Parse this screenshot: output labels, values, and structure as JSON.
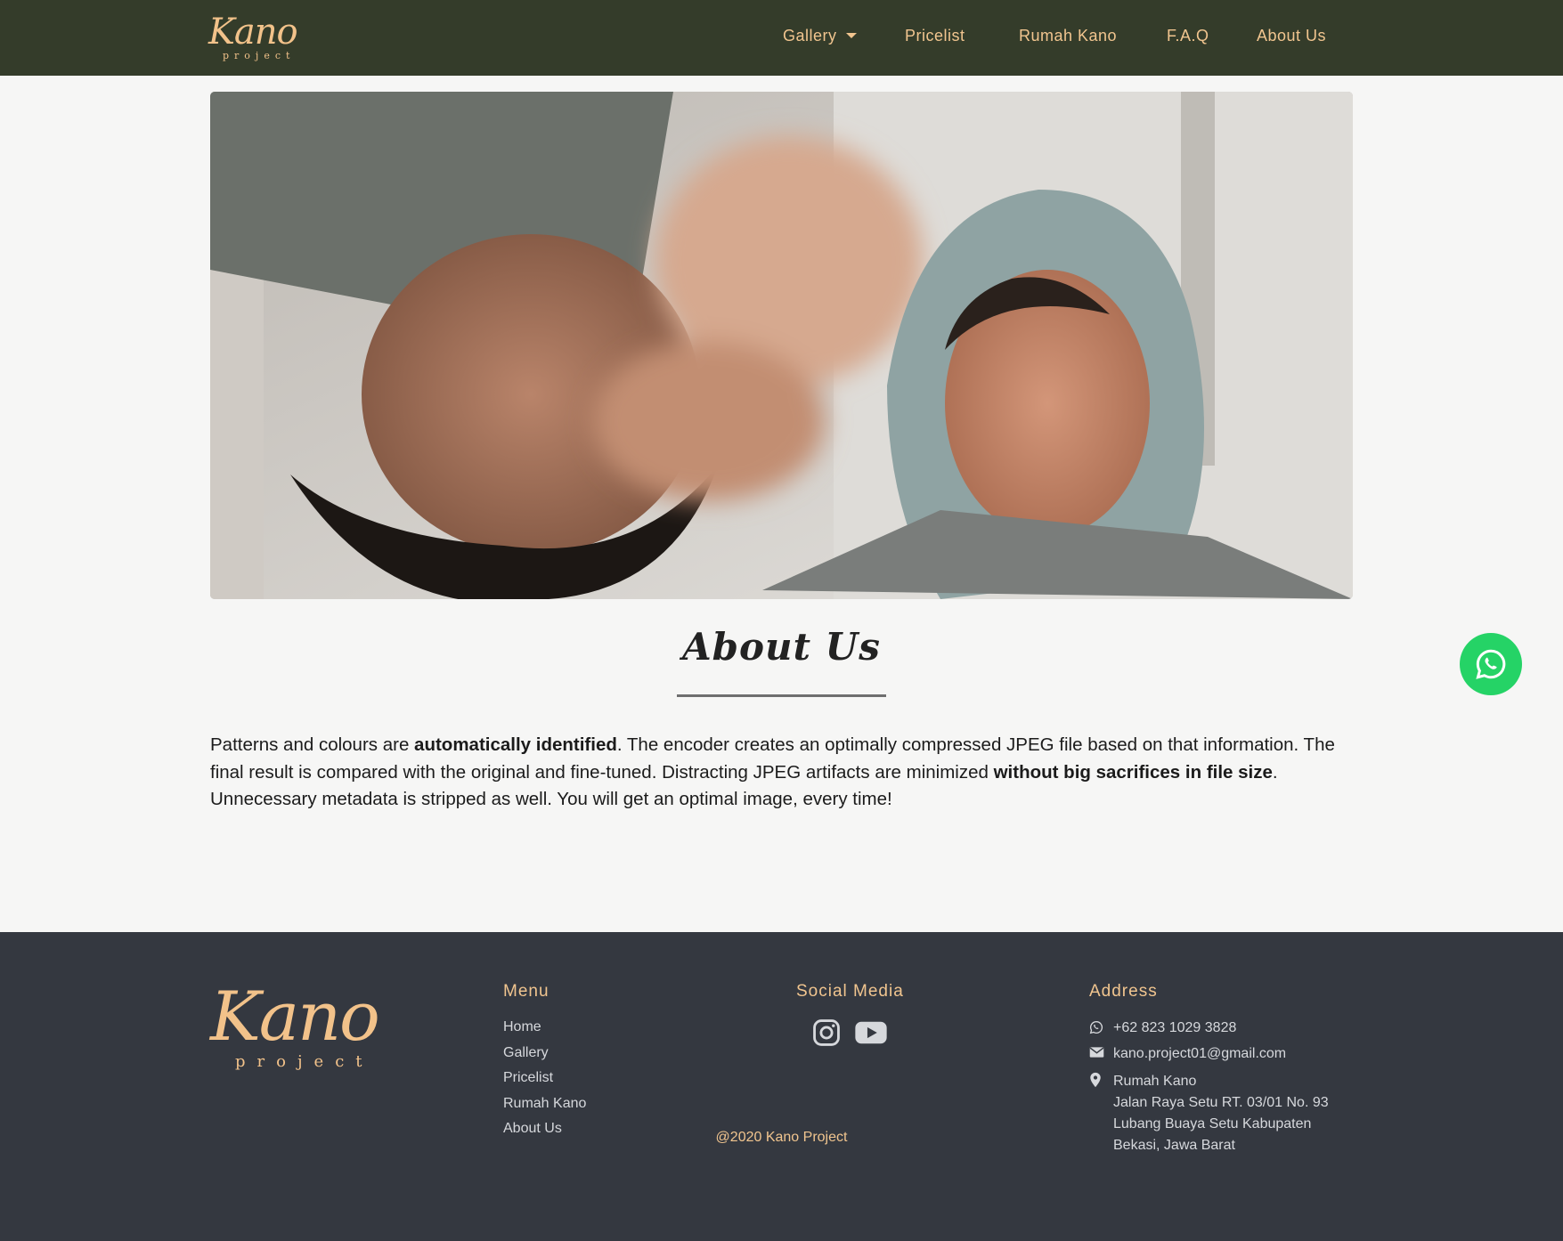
{
  "nav": {
    "brand_script": "Kano",
    "brand_sub": "project",
    "items": [
      {
        "label": "Gallery"
      },
      {
        "label": "Pricelist"
      },
      {
        "label": "Rumah Kano"
      },
      {
        "label": "F.A.Q"
      },
      {
        "label": "About Us"
      }
    ]
  },
  "about": {
    "title": "About Us",
    "text_parts": [
      "Patterns and colours are ",
      "automatically identified",
      ". The encoder creates an optimally compressed JPEG file based on that information. The final result is compared with the original and fine-tuned. Distracting JPEG artifacts are minimized ",
      "without big sacrifices in file size",
      ". Unnecessary metadata is stripped as well. You will get an optimal image, every time!"
    ]
  },
  "footer": {
    "logo_script": "Kano",
    "logo_sub": "project",
    "menu_heading": "Menu",
    "menu_items": [
      "Home",
      "Gallery",
      "Pricelist",
      "Rumah Kano",
      "About Us"
    ],
    "social_heading": "Social Media",
    "address_heading": "Address",
    "phone": "+62 823 1029 3828",
    "email": "kano.project01@gmail.com",
    "address_lines": [
      "Rumah Kano",
      "Jalan Raya Setu RT. 03/01 No. 93",
      "Lubang Buaya Setu Kabupaten",
      "Bekasi, Jawa Barat"
    ],
    "copyright": "@2020 Kano Project"
  },
  "icons": {
    "whatsapp_fab": "whatsapp-icon",
    "social": [
      "instagram-icon",
      "youtube-icon"
    ],
    "address": [
      "whatsapp-icon",
      "envelope-icon",
      "map-pin-icon"
    ]
  },
  "colors": {
    "navbar_bg": "#343c2a",
    "accent": "#f1c58f",
    "footer_bg": "#343840",
    "whatsapp": "#25d366",
    "page_bg": "#f6f6f5"
  }
}
